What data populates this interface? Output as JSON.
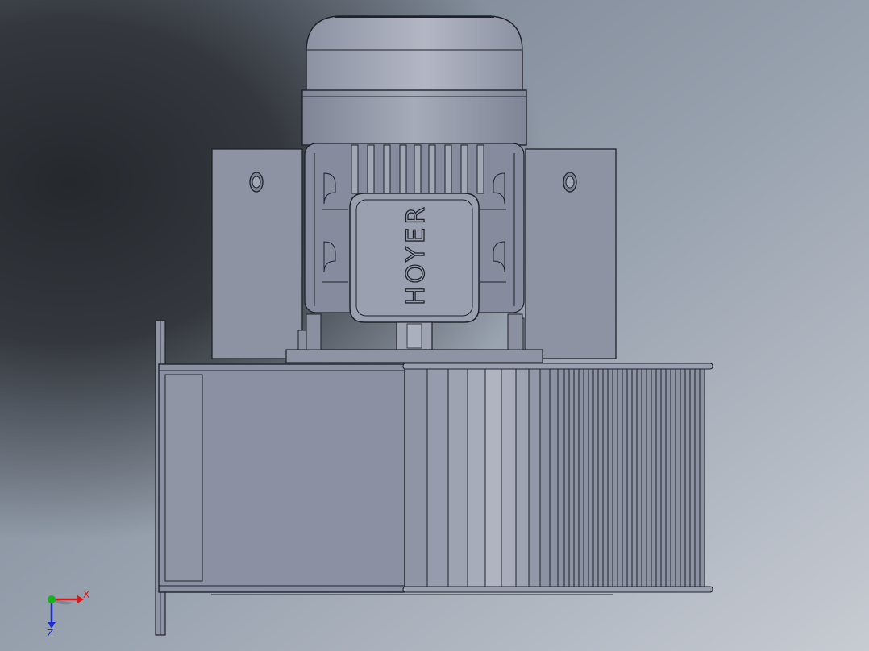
{
  "viewport": {
    "background_gradient": [
      "#2b2e33",
      "#8a93a0",
      "#c8ccd3"
    ]
  },
  "model": {
    "brand_label": "HOYER",
    "colors": {
      "body": "#9096a6",
      "body_light": "#a8adbb",
      "body_dark": "#7b8192",
      "edge": "#1f2229",
      "housing": "#8b91a2"
    }
  },
  "triad": {
    "x_label": "X",
    "z_label": "Z",
    "colors": {
      "x": "#d41a1a",
      "y": "#18b21a",
      "z": "#1c2bd4"
    }
  }
}
